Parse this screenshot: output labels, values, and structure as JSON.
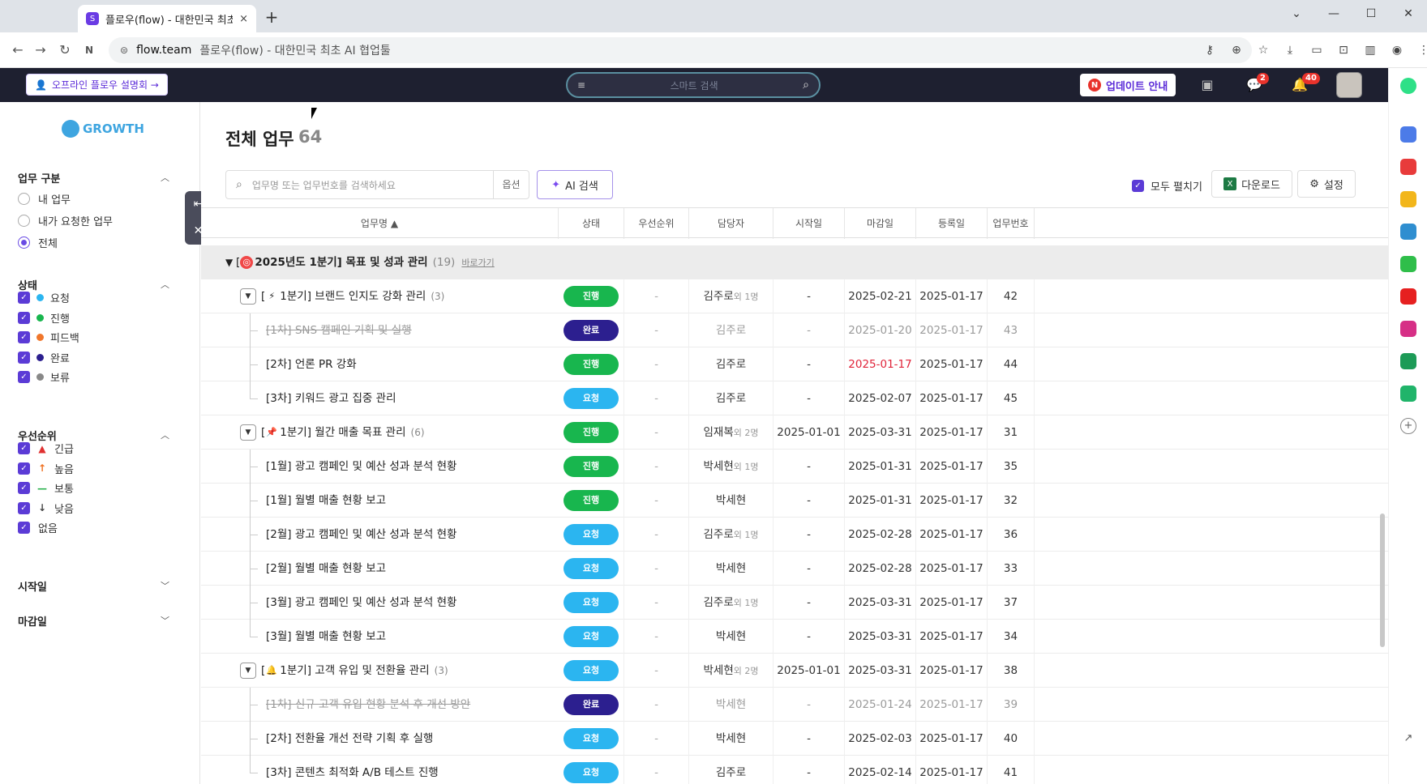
{
  "browser": {
    "tab_title": "플로우(flow) - 대한민국 최초",
    "tab_close": "×",
    "new_tab": "+",
    "url_host": "flow.team",
    "url_rest": "플로우(flow) - 대한민국 최초 AI 협업툴"
  },
  "header": {
    "offline_label": "오프라인 플로우 설명회 →",
    "search_placeholder": "스마트 검색",
    "update_label": "업데이트 안내",
    "update_n": "N",
    "chat_badge": "2",
    "bell_badge": "40"
  },
  "sidebar": {
    "logo_text": "GROWTH",
    "task_type": {
      "title": "업무 구분",
      "options": [
        "내 업무",
        "내가 요청한 업무",
        "전체"
      ],
      "selected": "전체"
    },
    "status": {
      "title": "상태",
      "items": [
        {
          "label": "요청",
          "color": "#2bb5f0"
        },
        {
          "label": "진행",
          "color": "#18b64e"
        },
        {
          "label": "피드백",
          "color": "#f0762b"
        },
        {
          "label": "완료",
          "color": "#2c1f8f"
        },
        {
          "label": "보류",
          "color": "#888888"
        }
      ]
    },
    "priority": {
      "title": "우선순위",
      "items": [
        {
          "label": "긴급",
          "icon": "alarm-icon",
          "color": "#e03030",
          "glyph": "▲"
        },
        {
          "label": "높음",
          "icon": "arrow-up-icon",
          "color": "#f07020",
          "glyph": "↑"
        },
        {
          "label": "보통",
          "icon": "dash-icon",
          "color": "#27b04a",
          "glyph": "—"
        },
        {
          "label": "낮음",
          "icon": "arrow-down-icon",
          "color": "#444444",
          "glyph": "↓"
        },
        {
          "label": "없음",
          "icon": "",
          "color": "",
          "glyph": ""
        }
      ]
    },
    "start_date": "시작일",
    "due_date": "마감일"
  },
  "main": {
    "title": "전체 업무",
    "count": "64",
    "search_placeholder": "업무명 또는 업무번호를 검색하세요",
    "search_option": "옵션",
    "ai_search": "AI 검색",
    "expand_all": "모두 펼치기",
    "download": "다운로드",
    "settings": "설정"
  },
  "table": {
    "columns": [
      "업무명 ▲",
      "상태",
      "우선순위",
      "담당자",
      "시작일",
      "마감일",
      "등록일",
      "업무번호"
    ],
    "group": {
      "title": "2025년도 1분기] 목표 및 성과 관리",
      "prefix": "[",
      "count": "(19)",
      "link": "바로가기"
    },
    "status_colors": {
      "진행": "#18b64e",
      "완료": "#2c1f8f",
      "요청": "#2bb5f0"
    },
    "rows": [
      {
        "level": 1,
        "toggle": true,
        "emoji": "⚡",
        "name": "1분기] 브랜드 인지도 강화 관리",
        "prefix": "[",
        "sub": "(3)",
        "status": "진행",
        "priority": "-",
        "assignee": "김주로",
        "extra": "외 1명",
        "start": "-",
        "due": "2025-02-21",
        "reg": "2025-01-17",
        "no": "42"
      },
      {
        "level": 2,
        "strike": true,
        "name": "[1차] SNS 캠페인 기획 및 실행",
        "status": "완료",
        "priority": "-",
        "assignee": "김주로",
        "extra": "",
        "start": "-",
        "due": "2025-01-20",
        "reg": "2025-01-17",
        "no": "43"
      },
      {
        "level": 2,
        "name": "[2차] 언론 PR 강화",
        "status": "진행",
        "priority": "-",
        "assignee": "김주로",
        "extra": "",
        "start": "-",
        "due": "2025-01-17",
        "due_red": true,
        "reg": "2025-01-17",
        "no": "44"
      },
      {
        "level": 2,
        "last": true,
        "name": "[3차] 키워드 광고 집중 관리",
        "status": "요청",
        "priority": "-",
        "assignee": "김주로",
        "extra": "",
        "start": "-",
        "due": "2025-02-07",
        "reg": "2025-01-17",
        "no": "45"
      },
      {
        "level": 1,
        "toggle": true,
        "emoji": "📌",
        "name": "1분기] 월간 매출 목표 관리",
        "prefix": "[",
        "sub": "(6)",
        "status": "진행",
        "priority": "-",
        "assignee": "임재복",
        "extra": "외 2명",
        "start": "2025-01-01",
        "due": "2025-03-31",
        "reg": "2025-01-17",
        "no": "31"
      },
      {
        "level": 2,
        "name": "[1월] 광고 캠페인 및 예산 성과 분석 현황",
        "status": "진행",
        "priority": "-",
        "assignee": "박세현",
        "extra": "외 1명",
        "start": "-",
        "due": "2025-01-31",
        "reg": "2025-01-17",
        "no": "35"
      },
      {
        "level": 2,
        "name": "[1월] 월별 매출 현황 보고",
        "status": "진행",
        "priority": "-",
        "assignee": "박세현",
        "extra": "",
        "start": "-",
        "due": "2025-01-31",
        "reg": "2025-01-17",
        "no": "32"
      },
      {
        "level": 2,
        "name": "[2월] 광고 캠페인 및 예산 성과 분석 현황",
        "status": "요청",
        "priority": "-",
        "assignee": "김주로",
        "extra": "외 1명",
        "start": "-",
        "due": "2025-02-28",
        "reg": "2025-01-17",
        "no": "36"
      },
      {
        "level": 2,
        "name": "[2월] 월별 매출 현황 보고",
        "status": "요청",
        "priority": "-",
        "assignee": "박세현",
        "extra": "",
        "start": "-",
        "due": "2025-02-28",
        "reg": "2025-01-17",
        "no": "33"
      },
      {
        "level": 2,
        "name": "[3월] 광고 캠페인 및 예산 성과 분석 현황",
        "status": "요청",
        "priority": "-",
        "assignee": "김주로",
        "extra": "외 1명",
        "start": "-",
        "due": "2025-03-31",
        "reg": "2025-01-17",
        "no": "37"
      },
      {
        "level": 2,
        "last": true,
        "name": "[3월] 월별 매출 현황 보고",
        "status": "요청",
        "priority": "-",
        "assignee": "박세현",
        "extra": "",
        "start": "-",
        "due": "2025-03-31",
        "reg": "2025-01-17",
        "no": "34"
      },
      {
        "level": 1,
        "toggle": true,
        "emoji": "🔔",
        "name": "1분기] 고객 유입 및 전환율 관리",
        "prefix": "[",
        "sub": "(3)",
        "status": "요청",
        "priority": "-",
        "assignee": "박세현",
        "extra": "외 2명",
        "start": "2025-01-01",
        "due": "2025-03-31",
        "reg": "2025-01-17",
        "no": "38"
      },
      {
        "level": 2,
        "strike": true,
        "name": "[1차] 신규 고객 유입 현황 분석 후 개선 방안",
        "status": "완료",
        "priority": "-",
        "assignee": "박세현",
        "extra": "",
        "start": "-",
        "due": "2025-01-24",
        "reg": "2025-01-17",
        "no": "39"
      },
      {
        "level": 2,
        "name": "[2차] 전환율 개선 전략 기획 후 실행",
        "status": "요청",
        "priority": "-",
        "assignee": "박세현",
        "extra": "",
        "start": "-",
        "due": "2025-02-03",
        "reg": "2025-01-17",
        "no": "40"
      },
      {
        "level": 2,
        "last": true,
        "name": "[3차] 콘텐츠 최적화 A/B 테스트 진행",
        "status": "요청",
        "priority": "-",
        "assignee": "김주로",
        "extra": "",
        "start": "-",
        "due": "2025-02-14",
        "reg": "2025-01-17",
        "no": "41"
      }
    ]
  }
}
